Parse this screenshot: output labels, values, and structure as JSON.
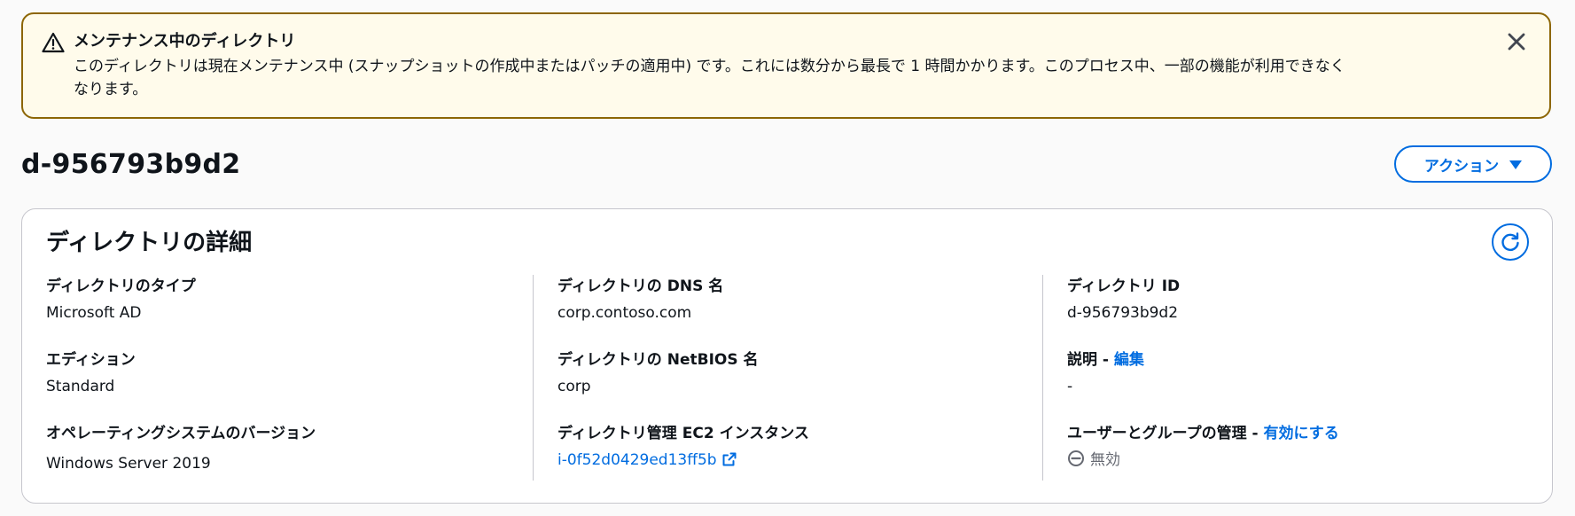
{
  "alert": {
    "icon": "warning-icon",
    "title": "メンテナンス中のディレクトリ",
    "body_line1": "このディレクトリは現在メンテナンス中 (スナップショットの作成中またはパッチの適用中) です。これには数分から最長で 1 時間かかります。このプロセス中、一部の機能が利用できなく",
    "body_line2": "なります。",
    "close_icon": "close-icon",
    "border_color": "#8d6605",
    "background": "#fffbeb"
  },
  "header": {
    "title": "d-956793b9d2",
    "action_label": "アクション"
  },
  "details": {
    "title": "ディレクトリの詳細",
    "refresh_icon": "refresh-icon",
    "col1": {
      "type_label": "ディレクトリのタイプ",
      "type_value": "Microsoft AD",
      "edition_label": "エディション",
      "edition_value": "Standard",
      "os_label": "オペレーティングシステムのバージョン",
      "os_value": "Windows Server 2019"
    },
    "col2": {
      "dns_label": "ディレクトリの DNS 名",
      "dns_value": "corp.contoso.com",
      "netbios_label": "ディレクトリの NetBIOS 名",
      "netbios_value": "corp",
      "ec2_label": "ディレクトリ管理 EC2 インスタンス",
      "ec2_value": "i-0f52d0429ed13ff5b",
      "ec2_icon": "external-link-icon"
    },
    "col3": {
      "id_label": "ディレクトリ ID",
      "id_value": "d-956793b9d2",
      "desc_label": "説明 -",
      "desc_edit_link": "編集",
      "desc_value": "-",
      "users_label": "ユーザーとグループの管理 -",
      "users_link": "有効にする",
      "users_status": "無効",
      "users_status_icon": "stopped-icon"
    }
  },
  "colors": {
    "accent": "#006ce0",
    "text": "#0f141a",
    "muted": "#656871"
  }
}
